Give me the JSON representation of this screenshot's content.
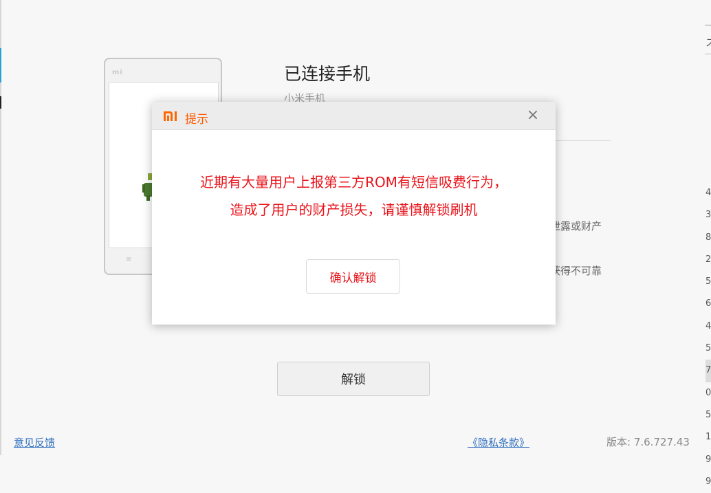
{
  "main": {
    "phone_logo": "mi",
    "heading": "已连接手机",
    "subheading": "小米手机",
    "tail_text_1": "泄露或财产",
    "tail_text_2": "获得不可靠",
    "unlock_button": "解锁"
  },
  "dialog": {
    "title": "提示",
    "brand_color": "#ff6700",
    "message": "近期有大量用户上报第三方ROM有短信吸费行为，造成了用户的财产损失，请谨慎解锁刷机",
    "confirm_button": "确认解锁",
    "close_icon": "close-icon"
  },
  "footer": {
    "feedback_link": "意见反馈",
    "privacy_link": "《隐私条款》",
    "version": "版本: 7.6.727.43"
  },
  "right_edge": {
    "digits": [
      "4",
      "3",
      "8",
      "2",
      "5",
      "6",
      "4",
      "5",
      "7",
      "0",
      "5",
      "1",
      "9",
      "9"
    ],
    "glyph": "ス"
  }
}
